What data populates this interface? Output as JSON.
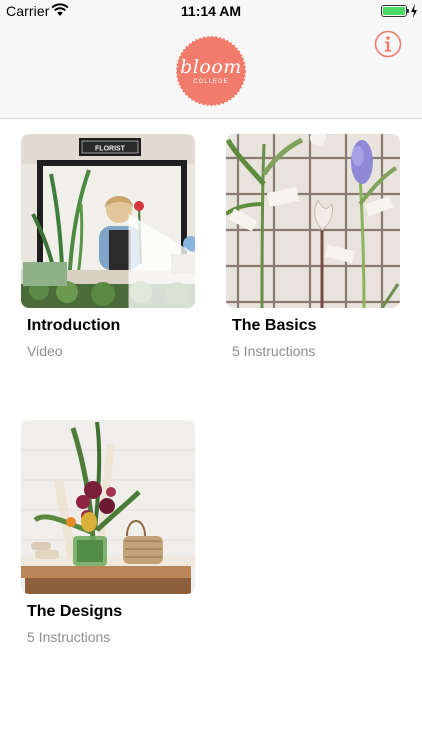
{
  "status_bar": {
    "carrier": "Carrier",
    "time": "11:14 AM",
    "battery_level": 1.0,
    "battery_color": "#4cd964"
  },
  "nav": {
    "logo_text": "bloom",
    "logo_subtext": "COLLEGE",
    "logo_color": "#f27c6c",
    "info_icon": "info-circle-icon"
  },
  "items": [
    {
      "title": "Introduction",
      "subtitle": "Video",
      "sign": "FLORIST",
      "has_play": true
    },
    {
      "title": "The Basics",
      "subtitle": "5 Instructions"
    },
    {
      "title": "The Designs",
      "subtitle": "5 Instructions"
    }
  ],
  "colors": {
    "accent": "#f27c6c",
    "subtitle": "#8e8e93"
  }
}
